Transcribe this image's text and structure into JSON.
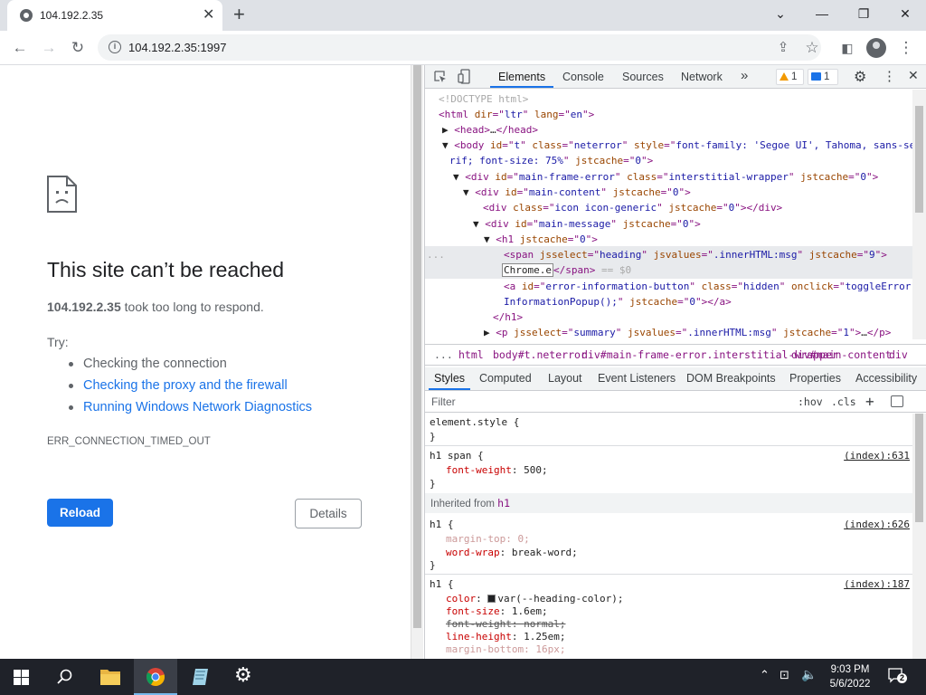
{
  "browser": {
    "tab_title": "104.192.2.35",
    "address": "104.192.2.35:1997"
  },
  "error_page": {
    "title": "This site can’t be reached",
    "summary_host": "104.192.2.35",
    "summary_rest": " took too long to respond.",
    "try_label": "Try:",
    "suggestions": [
      "Checking the connection",
      "Checking the proxy and the firewall",
      "Running Windows Network Diagnostics"
    ],
    "error_code": "ERR_CONNECTION_TIMED_OUT",
    "reload_label": "Reload",
    "details_label": "Details"
  },
  "devtools": {
    "tabs": [
      "Elements",
      "Console",
      "Sources",
      "Network"
    ],
    "more": "»",
    "warnings": "1",
    "messages": "1",
    "breadcrumbs": [
      "...",
      "html",
      "body#t.neterror",
      "div#main-frame-error.interstitial-wrapper",
      "div#main-content",
      "div"
    ],
    "sub_tabs": [
      "Styles",
      "Computed",
      "Layout",
      "Event Listeners",
      "DOM Breakpoints",
      "Properties",
      "Accessibility"
    ],
    "filter_placeholder": "Filter",
    "hov": ":hov",
    "cls": ".cls",
    "dom": {
      "doctype": "<!DOCTYPE html>",
      "selected_text": "Chrome.e",
      "eq0": " == $0",
      "dots": "..."
    },
    "styles": {
      "element_style": "element.style {",
      "close": "}",
      "h1span_selector": "h1 span {",
      "h1span_src": "(index):631",
      "h1span_prop": "font-weight",
      "h1span_val": "500;",
      "inherited_label": "Inherited from ",
      "inherited_tag": "h1",
      "h1a_selector": "h1 {",
      "h1a_src": "(index):626",
      "h1a_props": [
        {
          "name": "margin-top",
          "value": "0;"
        },
        {
          "name": "word-wrap",
          "value": "break-word;"
        }
      ],
      "h1b_selector": "h1 {",
      "h1b_src": "(index):187",
      "h1b_props": [
        {
          "name": "color",
          "value": "var(--heading-color);"
        },
        {
          "name": "font-size",
          "value": "1.6em;"
        },
        {
          "name": "font-weight",
          "value": "normal;"
        },
        {
          "name": "line-height",
          "value": "1.25em;"
        },
        {
          "name": "margin-bottom",
          "value": "16px;"
        }
      ]
    }
  },
  "taskbar": {
    "time": "9:03 PM",
    "date": "5/6/2022"
  }
}
